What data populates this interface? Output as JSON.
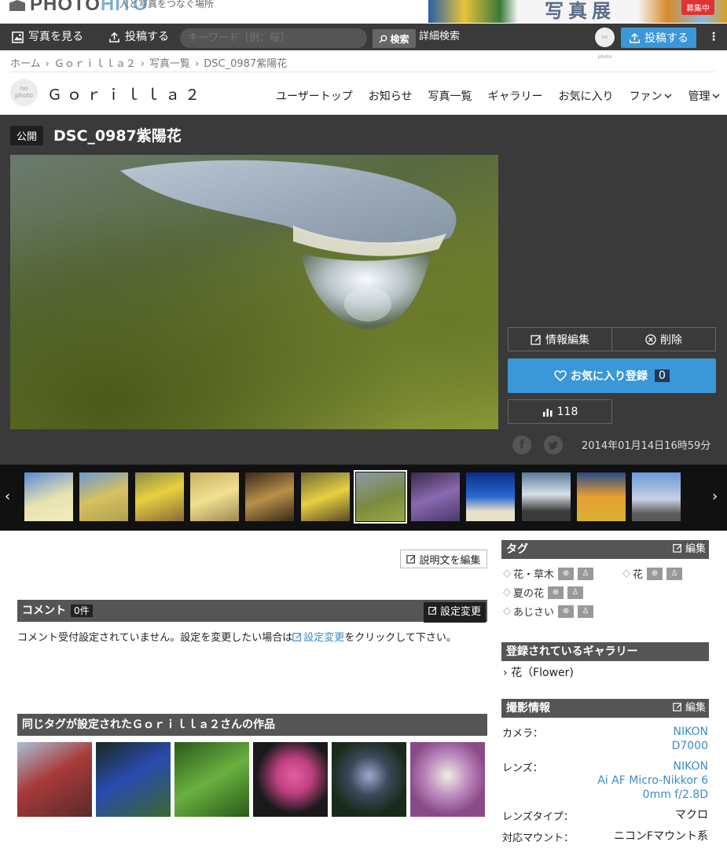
{
  "header": {
    "logo_main": "PHOTO",
    "logo_accent": "HITO",
    "tagline": "人と写真をつなぐ場所",
    "banner_title": "写真展",
    "banner_badge": "募集中"
  },
  "nav": {
    "view_photos": "写真を見る",
    "post": "投稿する",
    "search_placeholder": "キーワード［例：桜］",
    "search_button": "検索",
    "advanced_search": "詳細検索",
    "avatar_text": "no photo",
    "post_button": "投稿する",
    "menu": "⋮"
  },
  "breadcrumb": [
    "ホーム",
    "Ｇｏｒｉｌｌａ２",
    "写真一覧",
    "DSC_0987紫陽花"
  ],
  "user": {
    "avatar_text_1": "no",
    "avatar_text_2": "photo",
    "name": "Ｇｏｒｉｌｌａ２",
    "menu": [
      "ユーザートップ",
      "お知らせ",
      "写真一覧",
      "ギャラリー",
      "お気に入り",
      "ファン",
      "管理"
    ]
  },
  "photo": {
    "status_badge": "公開",
    "title": "DSC_0987紫陽花",
    "edit_info": "情報編集",
    "delete": "削除",
    "favorite_label": "お気に入り登録",
    "favorite_count": "0",
    "views": "118",
    "facebook": "f",
    "date": "2014年01月14日16時59分"
  },
  "filmstrip": {
    "prev": "‹",
    "next": "›",
    "active_index": 6,
    "thumbs": [
      {
        "bg": "linear-gradient(160deg,#5a8ad8,#e8e2b0 55%,#f2ecc0)"
      },
      {
        "bg": "linear-gradient(160deg,#6a9ad0,#d8c060 50%,#b0a050)"
      },
      {
        "bg": "linear-gradient(160deg,#8a8a4a,#e8d040 45%,#8a6a3a)"
      },
      {
        "bg": "linear-gradient(160deg,#c8b060,#f0e090 50%,#a08a50)"
      },
      {
        "bg": "linear-gradient(160deg,#3a2a1a,#b89048 50%,#3a2a1a)"
      },
      {
        "bg": "linear-gradient(160deg,#6a6a3a,#e8d040 50%,#5a4a2a)"
      },
      {
        "bg": "linear-gradient(160deg,#8a9aa8,#7a8a40 55%,#9aa840)"
      },
      {
        "bg": "linear-gradient(160deg,#3a2a4a,#8a6ab0 50%,#4a3a6a)"
      },
      {
        "bg": "linear-gradient(180deg,#0a2a8a,#2a6ad0 50%,#e8e0c8 80%)"
      },
      {
        "bg": "linear-gradient(180deg,#5a7a9a,#d8e0e8 45%,#3a3a3a 80%)"
      },
      {
        "bg": "linear-gradient(180deg,#2a4a8a,#e8a030 50%,#d8b030)"
      },
      {
        "bg": "linear-gradient(180deg,#6a9ad8,#c8d0e0 55%,#5a5a5a 85%)"
      }
    ]
  },
  "description": {
    "edit_label": "説明文を編集"
  },
  "comments": {
    "heading": "コメント",
    "count": "0件",
    "settings_label": "設定変更",
    "text_before": "コメント受付設定されていません。設定を変更したい場合は",
    "link_text": "設定変更",
    "text_after": "をクリックして下さい。"
  },
  "same_tag": {
    "heading": "同じタグが設定されたＧｏｒｉｌｌａ２さんの作品",
    "works": [
      {
        "bg": "linear-gradient(150deg,#a8c0d8,#a83a3a 45%,#5a2a2a)"
      },
      {
        "bg": "linear-gradient(150deg,#1a2a1a,#2a4ab0 45%,#3a6a2a)"
      },
      {
        "bg": "linear-gradient(150deg,#2a5a1a,#6ab040 50%,#2a5a1a)"
      },
      {
        "bg": "radial-gradient(circle at 55% 45%,#e060a0 0%,#c04080 30%,#1a1a1a 65%)"
      },
      {
        "bg": "radial-gradient(circle at 50% 45%,#a0a8d0 0%,#3a4a5a 35%,#1a2a1a 70%)"
      },
      {
        "bg": "radial-gradient(circle at 50% 45%,#f0f0e0 0%,#c090c0 35%,#8a4a8a 70%)"
      }
    ]
  },
  "tags": {
    "heading": "タグ",
    "edit_label": "編集",
    "items": [
      "花・草木",
      "花",
      "夏の花",
      "あじさい"
    ]
  },
  "gallery": {
    "heading": "登録されているギャラリー",
    "item": "花（Flower)"
  },
  "shooting": {
    "heading": "撮影情報",
    "edit_label": "編集",
    "camera_label": "カメラ：",
    "camera_value_1": "NIKON",
    "camera_value_2": "D7000",
    "lens_label": "レンズ：",
    "lens_value_1": "NIKON",
    "lens_value_2": "Ai AF Micro-Nikkor 6",
    "lens_value_3": "0mm f/2.8D",
    "lens_type_label": "レンズタイプ：",
    "lens_type_value": "マクロ",
    "mount_label": "対応マウント：",
    "mount_value": "ニコンFマウント系"
  },
  "colors": {
    "accent": "#3a97d8",
    "dark": "#3a3a3a",
    "link": "#3a8ec8"
  }
}
